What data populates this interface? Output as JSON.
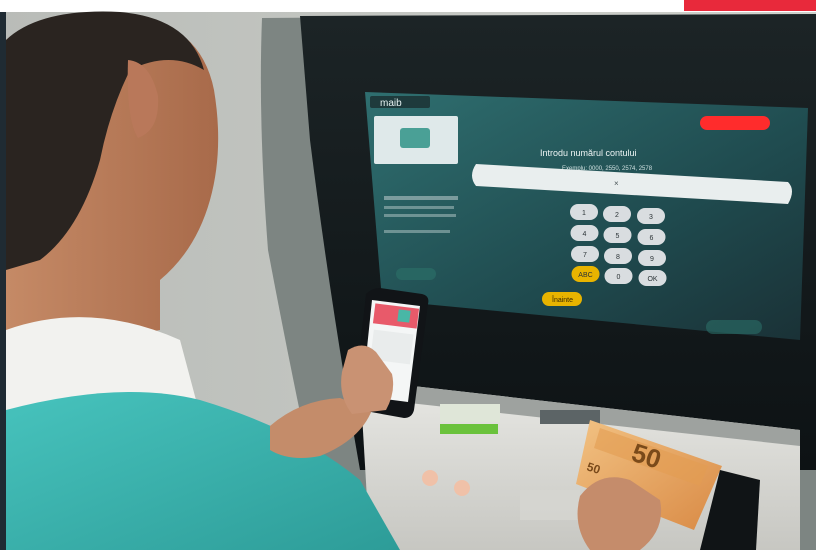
{
  "screen": {
    "brand": "maib",
    "prompt_title": "Introdu numărul contului",
    "prompt_hint": "Exemplu: 0000, 2550, 2574, 2578",
    "keypad": [
      "1",
      "2",
      "3",
      "4",
      "5",
      "6",
      "7",
      "8",
      "9",
      "ABC",
      "0",
      "OK"
    ],
    "continue_label": "Înainte"
  },
  "banknote": {
    "denomination": "50"
  },
  "colors": {
    "brand_red": "#e8293b",
    "screen_teal": "#3aa39c",
    "key_fill": "#d9dde0",
    "key_accent": "#e8b400",
    "shirt": "#3bb5b0",
    "note_orange": "#e9a35b"
  }
}
